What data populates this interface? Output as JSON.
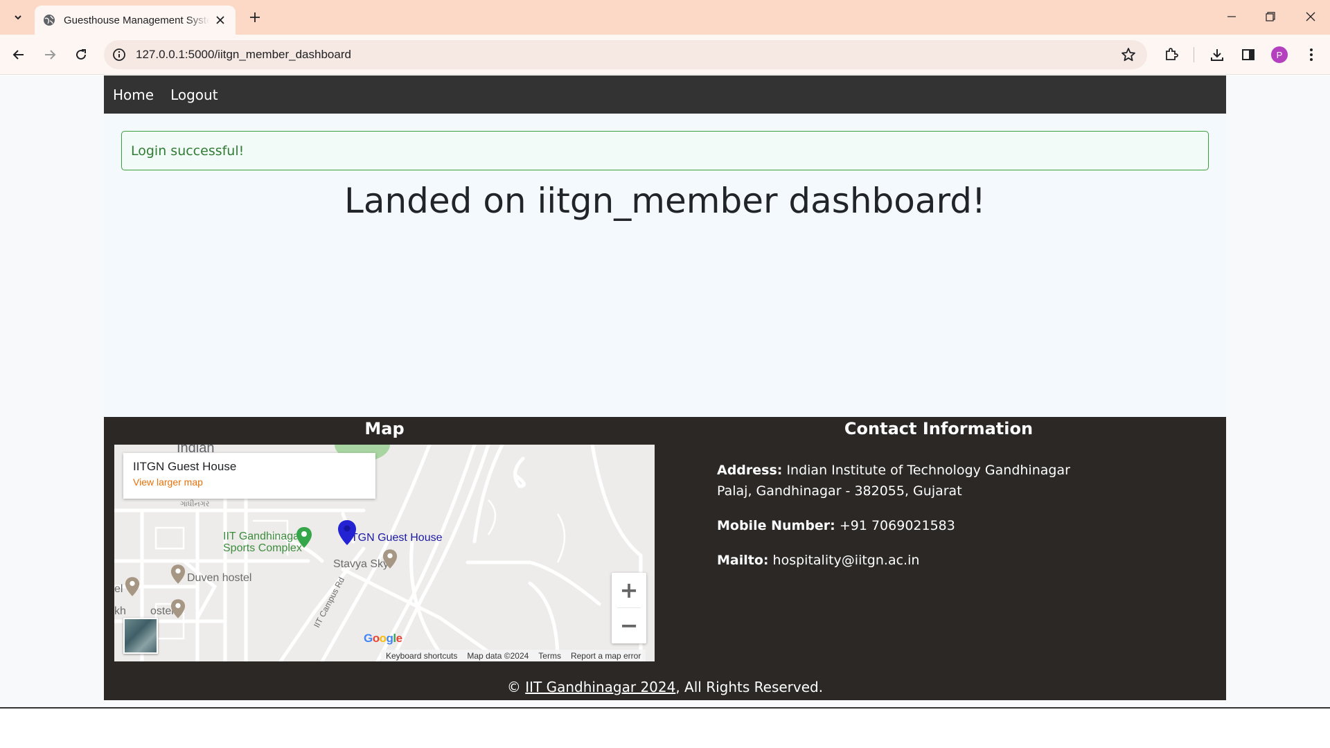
{
  "browser": {
    "tab_title": "Guesthouse Management System",
    "url": "127.0.0.1:5000/iitgn_member_dashboard",
    "profile_initial": "P",
    "icons": [
      "tab-search-icon",
      "globe-icon",
      "close-icon",
      "plus-icon",
      "minimize-icon",
      "restore-icon",
      "window-close-icon",
      "back-icon",
      "forward-icon",
      "reload-icon",
      "site-info-icon",
      "star-icon",
      "extensions-icon",
      "download-icon",
      "side-panel-icon",
      "kebab-menu-icon"
    ]
  },
  "nav": {
    "home": "Home",
    "logout": "Logout"
  },
  "alert": {
    "message": "Login successful!",
    "color": "#2e7d32"
  },
  "main": {
    "heading": "Landed on iitgn_member dashboard!"
  },
  "footer": {
    "map_heading": "Map",
    "contact_heading": "Contact Information",
    "address_label": "Address:",
    "address_line1": "Indian Institute of Technology Gandhinagar",
    "address_line2": "Palaj, Gandhinagar - 382055, Gujarat",
    "mobile_label": "Mobile Number:",
    "mobile_value": "+91 7069021583",
    "mailto_label": "Mailto:",
    "mailto_value": "hospitality@iitgn.ac.in",
    "copyright_symbol": "©",
    "copyright_link": "IIT Gandhinagar 2024",
    "copyright_rest": ", All Rights Reserved."
  },
  "map": {
    "card_title": "IITGN Guest House",
    "card_link": "View larger map",
    "labels": {
      "guest_house": "IITGN Guest House",
      "sports_line1": "IIT Gandhinagar",
      "sports_line2": "Sports Complex",
      "stavya": "Stavya Sky",
      "duven": "Duven hostel",
      "ostel": "ostel",
      "el": "el",
      "kh": "kh",
      "indian": "Indian",
      "campus_rd": "IIT Campus Rd",
      "local_script": "ગાંધીનગર"
    },
    "zoom_in": "+",
    "zoom_out": "−",
    "google": "Google",
    "attribution": {
      "shortcuts": "Keyboard shortcuts",
      "data": "Map data ©2024",
      "terms": "Terms",
      "report": "Report a map error"
    }
  }
}
